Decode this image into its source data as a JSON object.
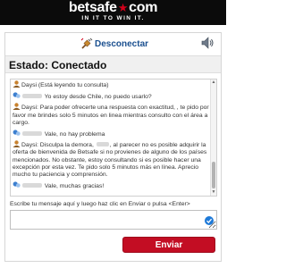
{
  "brand": {
    "name_left": "betsafe",
    "star": "★",
    "name_right": "com",
    "tagline": "IN IT TO WIN IT."
  },
  "toolbar": {
    "disconnect_label": "Desconectar"
  },
  "status": "Estado: Conectado",
  "transcript": {
    "reading_notice": "Daysi (Está leyendo tu consulta)",
    "messages": [
      {
        "from": "user",
        "text": " Yo estoy desde Chile, no puedo usarlo?"
      },
      {
        "from": "agent",
        "prefix": "Daysi: ",
        "text": "Para poder ofrecerte una respuesta con exactitud, , te pido por favor me brindes solo 5 minutos en linea mientras consulto con el área a cargo."
      },
      {
        "from": "user",
        "text": " Vale, no hay problema"
      },
      {
        "from": "agent",
        "prefix": "Daysi: ",
        "text_before": "Disculpa la demora, ",
        "text_after": ", al parecer no es posible adquirir la oferta de bienvenida de Betsafe si no provienes de alguno de los países mencionados. No obstante, estoy consultando si es posible hacer una excepción por esta vez. Te pido solo 5 minutos más en línea. Aprecio mucho tu paciencia y comprensión."
      },
      {
        "from": "user",
        "text": " Vale, muchas gracias!"
      }
    ]
  },
  "compose": {
    "prompt": "Escribe tu mensaje aquí y luego haz clic en Enviar o pulsa <Enter>",
    "value": "",
    "send_label": "Enviar"
  },
  "colors": {
    "header_bg": "#0b0b0b",
    "brand_red": "#c30d23",
    "link_blue": "#1a4f8f"
  }
}
